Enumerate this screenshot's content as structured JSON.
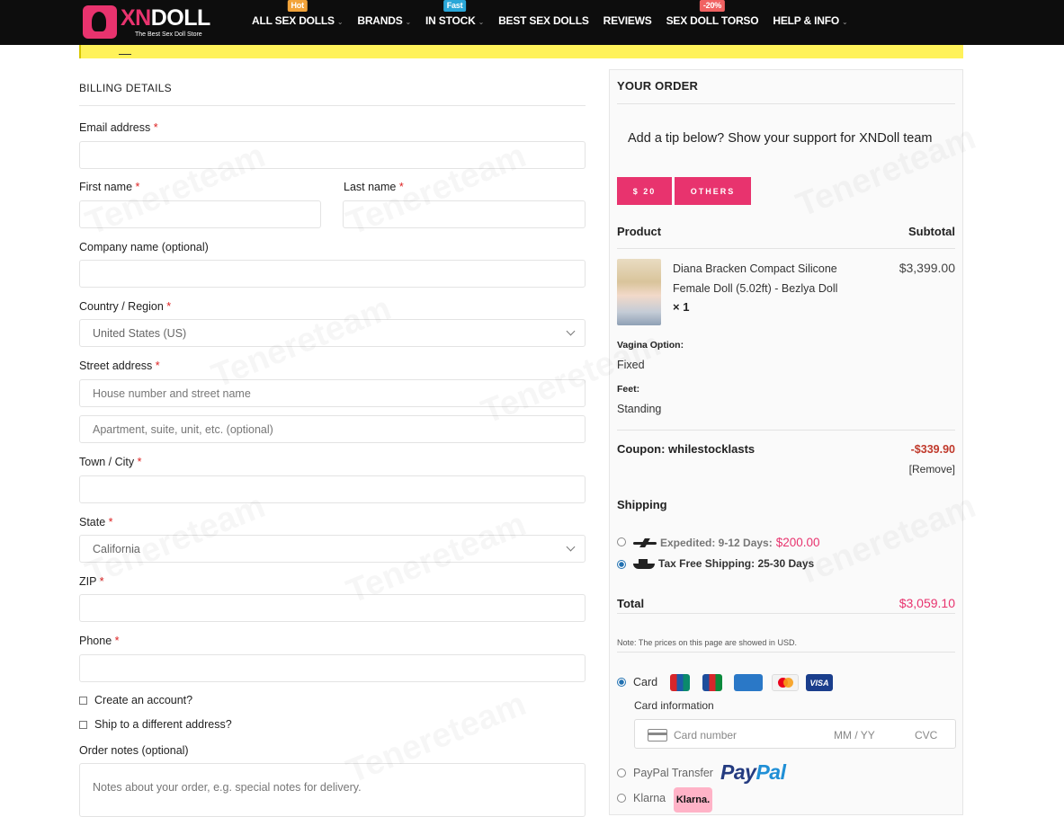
{
  "header": {
    "logo": {
      "brand_main": "XN",
      "brand_accent": "DOLL",
      "tagline": "The Best Sex Doll Store"
    },
    "nav": [
      {
        "label": "ALL SEX DOLLS",
        "badge": "Hot",
        "dropdown": true
      },
      {
        "label": "BRANDS",
        "badge": "",
        "dropdown": true
      },
      {
        "label": "IN STOCK",
        "badge": "Fast",
        "dropdown": true
      },
      {
        "label": "BEST SEX DOLLS",
        "badge": "",
        "dropdown": false
      },
      {
        "label": "REVIEWS",
        "badge": "",
        "dropdown": false
      },
      {
        "label": "SEX DOLL TORSO",
        "badge": "-20%",
        "dropdown": false
      },
      {
        "label": "HELP & INFO",
        "badge": "",
        "dropdown": true
      }
    ],
    "accent_color": "#e8336e"
  },
  "billing": {
    "title": "BILLING DETAILS",
    "required_mark": "*",
    "email": {
      "label": "Email address",
      "value": ""
    },
    "first_name": {
      "label": "First name",
      "value": ""
    },
    "last_name": {
      "label": "Last name",
      "value": ""
    },
    "company": {
      "label": "Company name (optional)",
      "value": ""
    },
    "country": {
      "label": "Country / Region",
      "value": "United States (US)"
    },
    "street": {
      "label": "Street address",
      "placeholder_1": "House number and street name",
      "placeholder_2": "Apartment, suite, unit, etc. (optional)"
    },
    "city": {
      "label": "Town / City",
      "value": ""
    },
    "state": {
      "label": "State",
      "value": "California"
    },
    "zip": {
      "label": "ZIP",
      "value": ""
    },
    "phone": {
      "label": "Phone",
      "value": ""
    },
    "create_account": "Create an account?",
    "ship_different": "Ship to a different address?",
    "notes": {
      "label": "Order notes (optional)",
      "placeholder": "Notes about your order, e.g. special notes for delivery."
    }
  },
  "order": {
    "title": "YOUR ORDER",
    "tip_text": "Add a tip below? Show your support for XNDoll team",
    "tip_buttons": [
      "$ 20",
      "OTHERS"
    ],
    "col_product": "Product",
    "col_subtotal": "Subtotal",
    "item": {
      "name": "Diana Bracken Compact Silicone Female Doll (5.02ft) - Bezlya Doll",
      "qty": "× 1",
      "price": "$3,399.00",
      "meta": [
        {
          "key": "Vagina Option:",
          "value": "Fixed"
        },
        {
          "key": "Feet:",
          "value": "Standing"
        }
      ]
    },
    "coupon": {
      "label": "Coupon: whilestocklasts",
      "amount": "-$339.90",
      "remove": "[Remove]"
    },
    "shipping": {
      "title": "Shipping",
      "options": [
        {
          "label": "Expedited: 9-12 Days:",
          "price": "$200.00",
          "selected": false
        },
        {
          "label": "Tax Free Shipping: 25-30 Days",
          "price": "",
          "selected": true
        }
      ]
    },
    "total_label": "Total",
    "total_value": "$3,059.10",
    "note": "Note: The prices on this page are showed in USD.",
    "payment": {
      "card_label": "Card",
      "card_brands": [
        "unionpay-icon",
        "jcb-icon",
        "amex-icon",
        "mastercard-icon",
        "visa-icon"
      ],
      "visa_text": "VISA",
      "card_info_label": "Card information",
      "card_number_placeholder": "Card number",
      "expiry_placeholder": "MM / YY",
      "cvc_placeholder": "CVC",
      "paypal_label": "PayPal Transfer",
      "paypal_logo": {
        "pay": "Pay",
        "pal": "Pal"
      },
      "klarna_label": "Klarna",
      "klarna_logo": "Klarna."
    }
  },
  "watermark": "Tenereteam"
}
